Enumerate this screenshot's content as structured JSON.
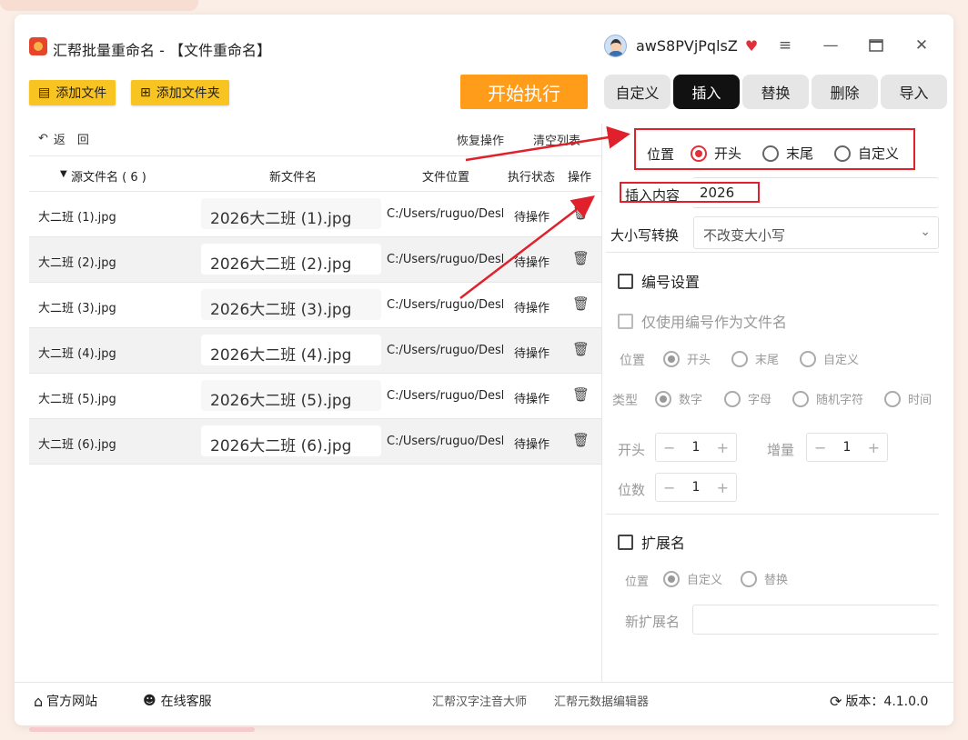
{
  "app": {
    "title": "汇帮批量重命名 - 【文件重命名】",
    "user": "awS8PVjPqlsZ",
    "vip_icon": "vip-heart-icon"
  },
  "toolbar": {
    "add_file": "添加文件",
    "add_folder": "添加文件夹",
    "start": "开始执行"
  },
  "tabs": [
    {
      "label": "自定义",
      "active": false
    },
    {
      "label": "插入",
      "active": true
    },
    {
      "label": "替换",
      "active": false
    },
    {
      "label": "删除",
      "active": false
    },
    {
      "label": "导入",
      "active": false
    }
  ],
  "list": {
    "back": "返　回",
    "restore": "恢复操作",
    "clear": "清空列表",
    "headers": {
      "source": "源文件名 ( 6 )",
      "new_name": "新文件名",
      "location": "文件位置",
      "status": "执行状态",
      "action": "操作"
    },
    "rows": [
      {
        "source": "大二班 (1).jpg",
        "new_name": "2026大二班 (1).jpg",
        "location": "C:/Users/ruguo/Desktop",
        "status": "待操作"
      },
      {
        "source": "大二班 (2).jpg",
        "new_name": "2026大二班 (2).jpg",
        "location": "C:/Users/ruguo/Desktop",
        "status": "待操作"
      },
      {
        "source": "大二班 (3).jpg",
        "new_name": "2026大二班 (3).jpg",
        "location": "C:/Users/ruguo/Desktop",
        "status": "待操作"
      },
      {
        "source": "大二班 (4).jpg",
        "new_name": "2026大二班 (4).jpg",
        "location": "C:/Users/ruguo/Desktop",
        "status": "待操作"
      },
      {
        "source": "大二班 (5).jpg",
        "new_name": "2026大二班 (5).jpg",
        "location": "C:/Users/ruguo/Desktop",
        "status": "待操作"
      },
      {
        "source": "大二班 (6).jpg",
        "new_name": "2026大二班 (6).jpg",
        "location": "C:/Users/ruguo/Desktop",
        "status": "待操作"
      }
    ]
  },
  "insert": {
    "position_label": "位置",
    "positions": [
      "开头",
      "末尾",
      "自定义"
    ],
    "selected_position": "开头",
    "content_label": "插入内容",
    "content_value": "2026",
    "case_label": "大小写转换",
    "case_value": "不改变大小写"
  },
  "numbering": {
    "title": "编号设置",
    "only_number": "仅使用编号作为文件名",
    "position_label": "位置",
    "positions": [
      "开头",
      "末尾",
      "自定义"
    ],
    "type_label": "类型",
    "types": [
      "数字",
      "字母",
      "随机字符",
      "时间"
    ],
    "start_label": "开头",
    "start_value": "1",
    "step_label": "增量",
    "step_value": "1",
    "digits_label": "位数",
    "digits_value": "1"
  },
  "extension": {
    "title": "扩展名",
    "position_label": "位置",
    "options": [
      "自定义",
      "替换"
    ],
    "new_ext_label": "新扩展名",
    "new_ext_value": ""
  },
  "footer": {
    "website": "官方网站",
    "support": "在线客服",
    "link1": "汇帮汉字注音大师",
    "link2": "汇帮元数据编辑器",
    "version": "版本：4.1.0.0"
  },
  "colors": {
    "accent_yellow": "#f8c421",
    "start_orange": "#ff9c1a",
    "active_tab": "#111111",
    "highlight_red": "#e0202a"
  }
}
